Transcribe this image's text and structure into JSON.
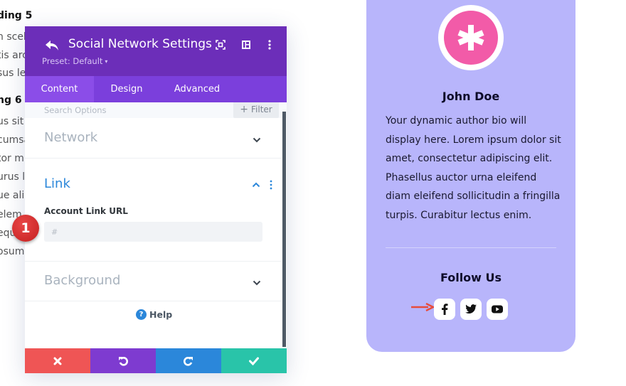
{
  "background_page": {
    "heading_5": "ding 5",
    "lines_a": [
      "n scel",
      "tis arc",
      "sus le"
    ],
    "heading_6": "ng 6",
    "lines_b": [
      "us sit a",
      "cumsa",
      "tor m",
      "urus l",
      "ue alic",
      "elem",
      "equ",
      "osum"
    ]
  },
  "modal": {
    "title": "Social Network Settings",
    "preset": "Preset: Default",
    "preset_caret": "▾",
    "header_icons": [
      "back-icon",
      "focus-mode-icon",
      "split-view-icon",
      "more-options-icon"
    ],
    "tabs": [
      {
        "label": "Content",
        "active": true
      },
      {
        "label": "Design",
        "active": false
      },
      {
        "label": "Advanced",
        "active": false
      }
    ],
    "search": {
      "placeholder": "Search Options",
      "value": ""
    },
    "filter": {
      "icon": "+",
      "label": "Filter"
    },
    "sections": {
      "network": {
        "title": "Network",
        "expanded": false
      },
      "link": {
        "title": "Link",
        "expanded": true,
        "field_label": "Account Link URL",
        "field_placeholder": "#",
        "field_value": ""
      },
      "background": {
        "title": "Background",
        "expanded": false
      }
    },
    "help": {
      "icon": "?",
      "label": "Help"
    },
    "footer": {
      "buttons": [
        {
          "name": "cancel",
          "icon": "close-icon",
          "color": "#ef5555"
        },
        {
          "name": "undo",
          "icon": "undo-icon",
          "color": "#7e3bd0"
        },
        {
          "name": "redo",
          "icon": "redo-icon",
          "color": "#2b87da"
        },
        {
          "name": "save",
          "icon": "check-icon",
          "color": "#29c4a9"
        }
      ]
    },
    "colors": {
      "header": "#6c2eb9",
      "tabs": "#7b3fdc",
      "accent": "#2b87da"
    }
  },
  "step_badge": {
    "number": "1",
    "color": "#d42a2a"
  },
  "author_card": {
    "name": "John Doe",
    "bio": "Your dynamic author bio will display here. Lorem ipsum dolor sit amet, consectetur adipiscing elit. Phasellus auctor urna eleifend diam eleifend sollicitudin a fringilla turpis. Curabitur lectus enim.",
    "follow_title": "Follow Us",
    "social_icons": [
      "facebook-icon",
      "twitter-icon",
      "youtube-icon"
    ],
    "colors": {
      "card": "#b8b5fb",
      "avatar": "#f25ba8",
      "arrow": "#e74c3c"
    }
  }
}
